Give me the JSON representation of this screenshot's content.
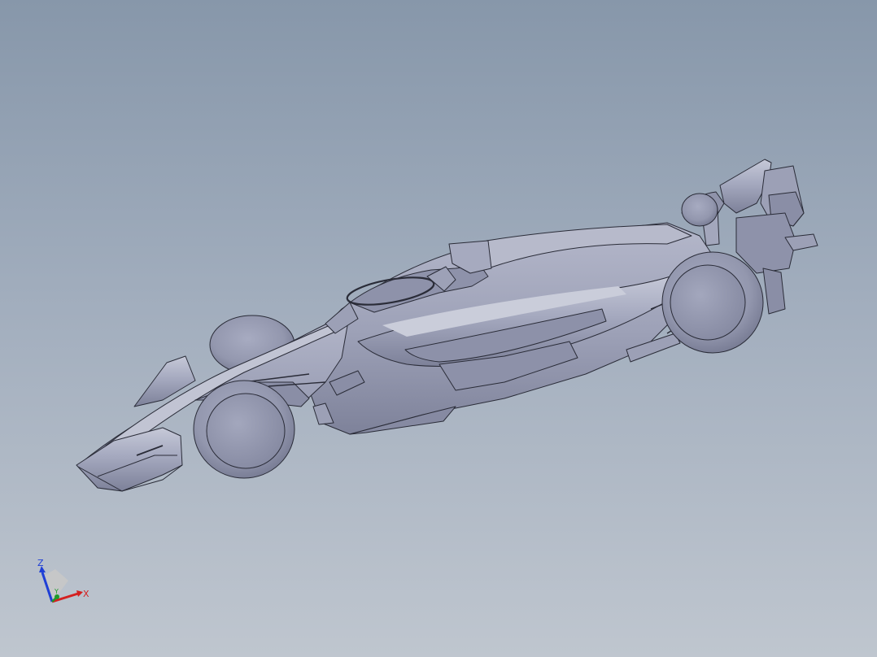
{
  "view": {
    "background_top": "#8797aa",
    "background_bottom": "#bfc6cf"
  },
  "model": {
    "body_color": "#9fa3b9",
    "shade_color": "#7f839b",
    "highlight_color": "#c4c7d6",
    "edge_color": "#2a2c38"
  },
  "triad": {
    "z_label": "Z",
    "x_label": "X",
    "y_label": "Y",
    "z_color": "#1f3fd6",
    "x_color": "#d42020",
    "y_color": "#1d9a2a"
  }
}
